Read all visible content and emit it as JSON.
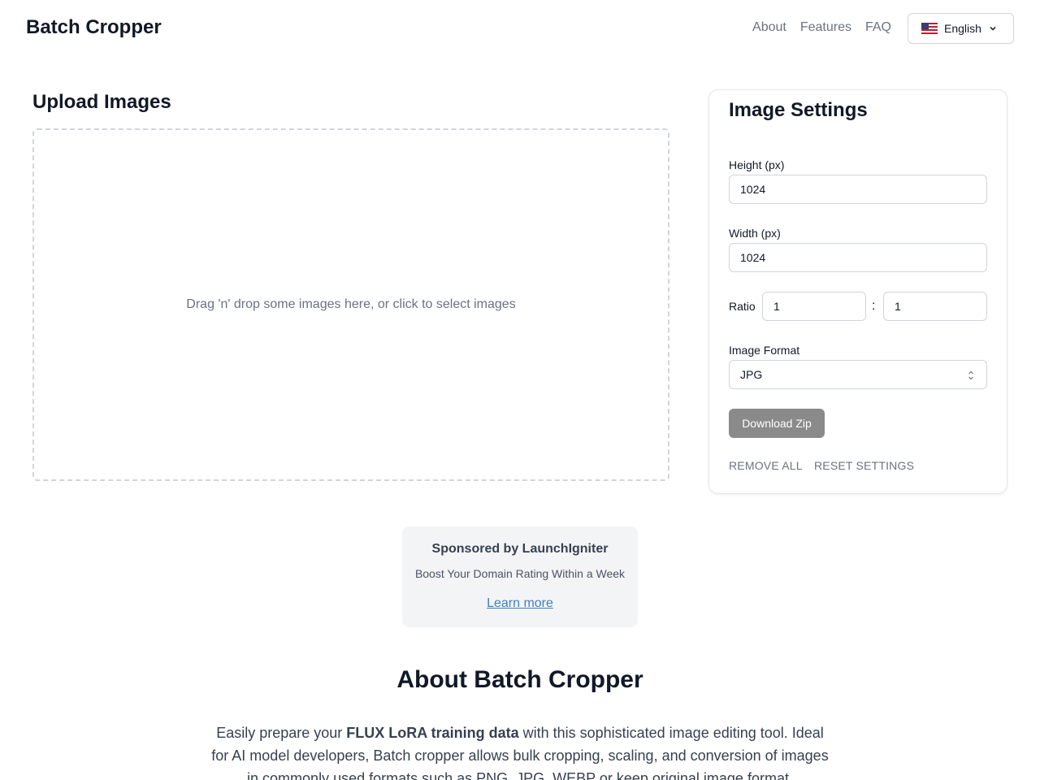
{
  "header": {
    "brand": "Batch Cropper",
    "nav": [
      "About",
      "Features",
      "FAQ"
    ],
    "language": "English"
  },
  "upload": {
    "title": "Upload Images",
    "drop_text": "Drag 'n' drop some images here, or click to select images"
  },
  "settings": {
    "title": "Image Settings",
    "height_label": "Height (px)",
    "height_value": "1024",
    "width_label": "Width (px)",
    "width_value": "1024",
    "ratio_label": "Ratio",
    "ratio_separator": ":",
    "ratio_w": "1",
    "ratio_h": "1",
    "format_label": "Image Format",
    "format_value": "JPG",
    "download_label": "Download Zip",
    "remove_all_label": "REMOVE ALL",
    "reset_label": "RESET SETTINGS"
  },
  "sponsor": {
    "title": "Sponsored by LaunchIgniter",
    "subtitle": "Boost Your Domain Rating Within a Week",
    "link": "Learn more"
  },
  "about": {
    "title": "About Batch Cropper",
    "text_before": "Easily prepare your ",
    "text_bold": "FLUX LoRA training data",
    "text_after": " with this sophisticated image editing tool. Ideal for AI model developers, Batch cropper allows bulk cropping, scaling, and conversion of images in commonly used formats such as PNG, JPG, WEBP or keep original image format."
  },
  "colors": {
    "button_disabled": "#8a8a8a",
    "link": "#3b82c4",
    "border": "#d1d5db"
  },
  "icons": [
    "us-flag-icon",
    "chevron-down-icon",
    "select-updown-icon"
  ]
}
